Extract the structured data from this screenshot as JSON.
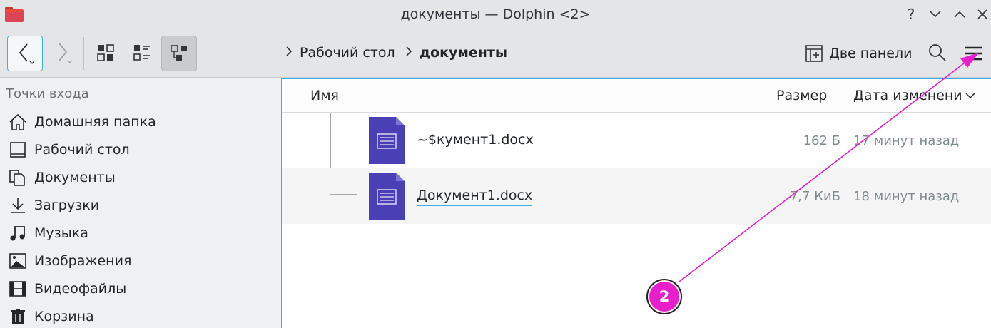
{
  "window": {
    "title": "документы — Dolphin <2>",
    "help": "?",
    "minimize": "⌄",
    "maximize": "⌃",
    "close": "✕"
  },
  "toolbar": {
    "breadcrumb": [
      "Рабочий стол",
      "документы"
    ],
    "split_label": "Две панели"
  },
  "sidebar": {
    "header": "Точки входа",
    "items": [
      {
        "label": "Домашняя папка",
        "icon": "home-icon"
      },
      {
        "label": "Рабочий стол",
        "icon": "desktop-icon"
      },
      {
        "label": "Документы",
        "icon": "documents-icon"
      },
      {
        "label": "Загрузки",
        "icon": "downloads-icon"
      },
      {
        "label": "Музыка",
        "icon": "music-icon"
      },
      {
        "label": "Изображения",
        "icon": "pictures-icon"
      },
      {
        "label": "Видеофайлы",
        "icon": "videos-icon"
      },
      {
        "label": "Корзина",
        "icon": "trash-icon"
      }
    ]
  },
  "columns": {
    "name": "Имя",
    "size": "Размер",
    "date": "Дата изменени"
  },
  "files": [
    {
      "name": "~$кумент1.docx",
      "size": "162 Б",
      "date": "17 минут назад"
    },
    {
      "name": "Документ1.docx",
      "size": "7,7 КиБ",
      "date": "18 минут назад"
    }
  ],
  "annotation": {
    "label": "2",
    "color": "#e81ecb"
  },
  "colors": {
    "accent": "#3daee9",
    "doc_icon": "#4a3fb5"
  }
}
